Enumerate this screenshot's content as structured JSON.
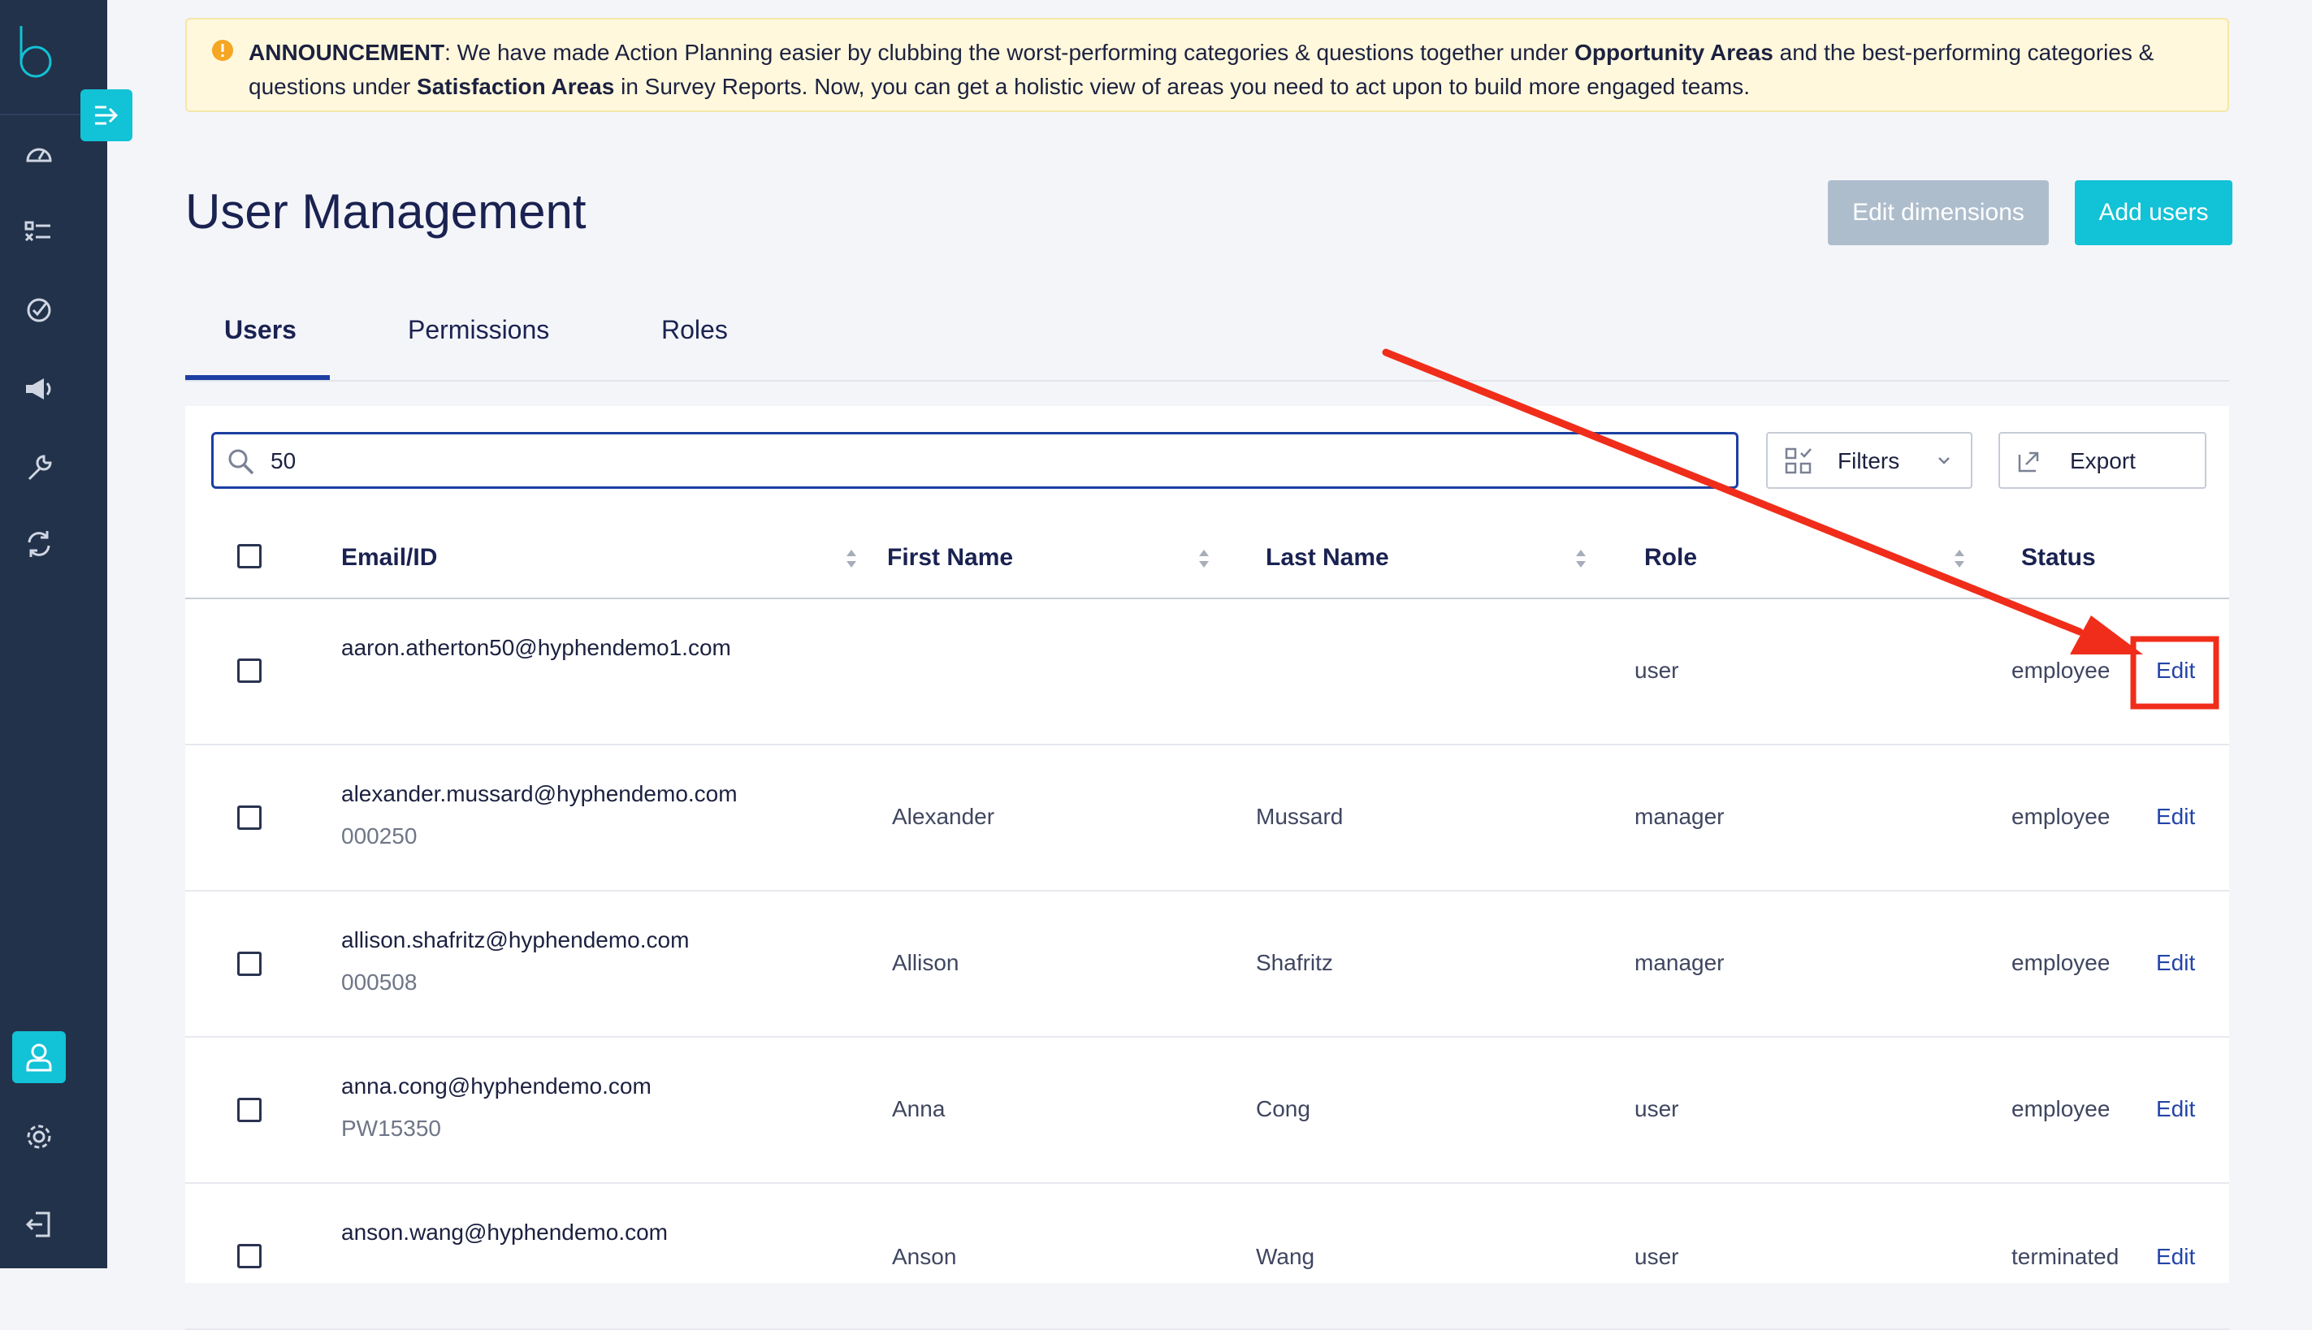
{
  "announcement": {
    "prefix": "ANNOUNCEMENT",
    "text_1": ": We have made Action Planning easier by clubbing the worst-performing categories & questions  together under ",
    "bold_1": "Opportunity Areas",
    "text_2": " and the best-performing  categories & questions under ",
    "bold_2": "Satisfaction Areas",
    "text_3": " in Survey Reports.  Now, you can get a holistic view of areas you need to act upon to build more engaged teams."
  },
  "header": {
    "title": "User Management",
    "edit_dimensions_label": "Edit dimensions",
    "add_users_label": "Add users"
  },
  "tabs": [
    {
      "label": "Users",
      "active": true
    },
    {
      "label": "Permissions",
      "active": false
    },
    {
      "label": "Roles",
      "active": false
    }
  ],
  "toolbar": {
    "search_value": "50",
    "filters_label": "Filters",
    "export_label": "Export"
  },
  "table": {
    "columns": [
      "Email/ID",
      "First Name",
      "Last Name",
      "Role",
      "Status"
    ],
    "edit_label": "Edit",
    "rows": [
      {
        "email": "aaron.atherton50@hyphendemo1.com",
        "id": "",
        "first": "",
        "last": "",
        "role": "user",
        "status": "employee"
      },
      {
        "email": "alexander.mussard@hyphendemo.com",
        "id": "000250",
        "first": "Alexander",
        "last": "Mussard",
        "role": "manager",
        "status": "employee"
      },
      {
        "email": "allison.shafritz@hyphendemo.com",
        "id": "000508",
        "first": "Allison",
        "last": "Shafritz",
        "role": "manager",
        "status": "employee"
      },
      {
        "email": "anna.cong@hyphendemo.com",
        "id": "PW15350",
        "first": "Anna",
        "last": "Cong",
        "role": "user",
        "status": "employee"
      },
      {
        "email": "anson.wang@hyphendemo.com",
        "id": "",
        "first": "Anson",
        "last": "Wang",
        "role": "user",
        "status": "terminated"
      }
    ]
  },
  "colors": {
    "sidebar": "#22324a",
    "accent": "#12c2d6",
    "primary_blue": "#1b3fa3",
    "annotation_red": "#f02d1a"
  },
  "icons": [
    "logo-icon",
    "collapse-sidebar-icon",
    "dashboard-icon",
    "surveys-icon",
    "action-plan-icon",
    "announcements-icon",
    "tools-icon",
    "sync-icon",
    "user-icon",
    "settings-icon",
    "logout-icon",
    "warning-icon",
    "search-icon",
    "filter-icon",
    "chevron-down-icon",
    "export-icon",
    "sort-icon"
  ]
}
